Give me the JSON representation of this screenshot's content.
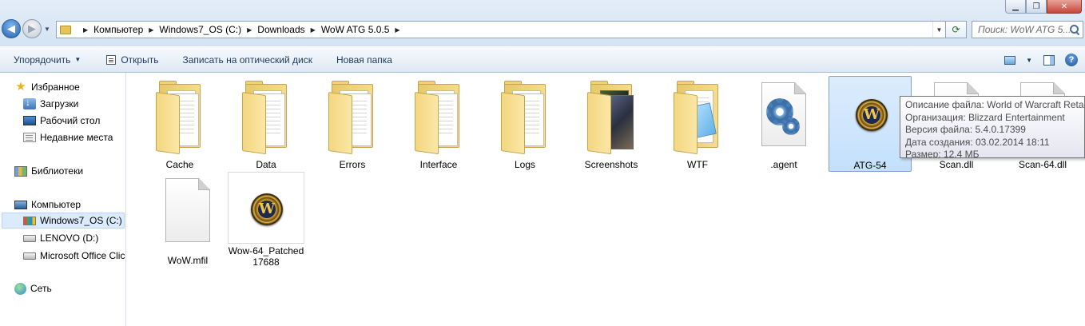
{
  "window": {
    "minimize_icon": "minimize-icon",
    "maximize_icon": "maximize-icon",
    "close_icon": "close-icon"
  },
  "address": {
    "breadcrumbs": [
      "Компьютер",
      "Windows7_OS (C:)",
      "Downloads",
      "WoW ATG 5.0.5"
    ],
    "search_placeholder": "Поиск: WoW ATG 5...."
  },
  "toolbar": {
    "organize": "Упорядочить",
    "open": "Открыть",
    "burn": "Записать на оптический диск",
    "new_folder": "Новая папка"
  },
  "sidebar": {
    "items": [
      {
        "label": "Избранное",
        "icon": "star-icon"
      },
      {
        "label": "Загрузки",
        "icon": "downloads-icon"
      },
      {
        "label": "Рабочий стол",
        "icon": "desktop-icon"
      },
      {
        "label": "Недавние места",
        "icon": "recent-places-icon"
      },
      {
        "label": "Библиотеки",
        "icon": "libraries-icon"
      },
      {
        "label": "Компьютер",
        "icon": "computer-icon"
      },
      {
        "label": "Windows7_OS (C:)",
        "icon": "windows-drive-icon"
      },
      {
        "label": "LENOVO (D:)",
        "icon": "drive-icon"
      },
      {
        "label": "Microsoft Office Clic",
        "icon": "drive-icon"
      },
      {
        "label": "Сеть",
        "icon": "network-icon"
      }
    ]
  },
  "files": [
    {
      "name": "Cache",
      "kind": "folder-docs"
    },
    {
      "name": "Data",
      "kind": "folder-docs"
    },
    {
      "name": "Errors",
      "kind": "folder-docs"
    },
    {
      "name": "Interface",
      "kind": "folder-docs"
    },
    {
      "name": "Logs",
      "kind": "folder-docs"
    },
    {
      "name": "Screenshots",
      "kind": "folder-photos"
    },
    {
      "name": "WTF",
      "kind": "folder-wtf"
    },
    {
      "name": ".agent",
      "kind": "config-file"
    },
    {
      "name": "ATG-54",
      "kind": "wow-exe"
    },
    {
      "name": "Scan.dll",
      "kind": "dll-file"
    },
    {
      "name": "Scan-64.dll",
      "kind": "dll-file"
    },
    {
      "name": "WoW.mfil",
      "kind": "blank-file"
    },
    {
      "name": "Wow-64_Patched\n17688",
      "kind": "wow-exe"
    }
  ],
  "tooltip": {
    "lines": [
      "Описание файла: World of Warcraft Retail",
      "Организация: Blizzard Entertainment",
      "Версия файла: 5.4.0.17399",
      "Дата создания: 03.02.2014 18:11",
      "Размер: 12,4 МБ"
    ]
  }
}
